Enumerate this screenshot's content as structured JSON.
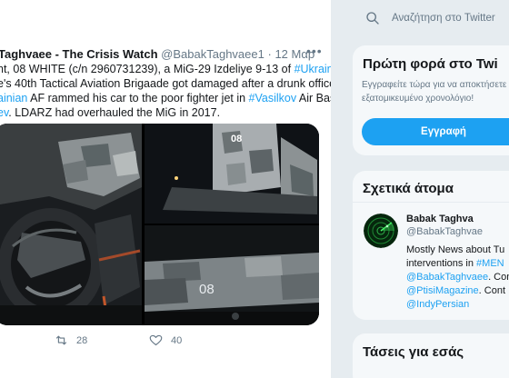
{
  "tweet": {
    "author_name": "Taghvaee - The Crisis Watch",
    "author_handle": "@BabakTaghvaee1",
    "separator": "·",
    "date": "12 Μαρ",
    "more_icon": "more-horizontal-icon",
    "text_lines": [
      {
        "segments": [
          {
            "text": "nt, 08 WHITE (c/n 2960731239), a MiG-29 Izdeliye 9-13 of ",
            "type": "text"
          },
          {
            "text": "#Ukraine",
            "type": "hashtag"
          }
        ]
      },
      {
        "segments": [
          {
            "text": "e's 40th Tactical Aviation Brigaade got damaged after a drunk officer",
            "type": "text"
          }
        ]
      },
      {
        "segments": [
          {
            "text": "ainian",
            "type": "hashtag"
          },
          {
            "text": " AF rammed his car to the poor fighter jet in ",
            "type": "text"
          },
          {
            "text": "#Vasilkov",
            "type": "hashtag"
          },
          {
            "text": " Air Base",
            "type": "text"
          }
        ]
      },
      {
        "segments": [
          {
            "text": "ev",
            "type": "hashtag"
          },
          {
            "text": ". LDARZ had overhauled the MiG in 2017.",
            "type": "text"
          }
        ]
      }
    ],
    "media": [
      {
        "id": "photo-damaged-engine",
        "alt": ""
      },
      {
        "id": "photo-tail-fins",
        "alt": ""
      },
      {
        "id": "photo-fuselage",
        "alt": "",
        "marking": "08"
      }
    ],
    "actions": {
      "retweet_icon": "retweet-icon",
      "retweet_count": "28",
      "like_icon": "heart-icon",
      "like_count": "40"
    }
  },
  "sidebar": {
    "search": {
      "icon": "search-icon",
      "placeholder": "Αναζήτηση στο Twitter"
    },
    "signup": {
      "title": "Πρώτη φορά στο Twi",
      "desc_lines": [
        "Εγγραφείτε τώρα για να αποκτήσετε το",
        "εξατομικευμένο χρονολόγιο!"
      ],
      "button_label": "Εγγραφή"
    },
    "relevant": {
      "title": "Σχετικά άτομα",
      "person": {
        "avatar_icon": "radar-avatar",
        "name": "Babak Taghva",
        "handle": "@BabakTaghvae",
        "bio_lines": [
          {
            "segments": [
              {
                "text": "Mostly News about Tu",
                "type": "text"
              }
            ]
          },
          {
            "segments": [
              {
                "text": "interventions in ",
                "type": "text"
              },
              {
                "text": "#MEN",
                "type": "hashtag"
              }
            ]
          },
          {
            "segments": [
              {
                "text": "@BabakTaghvaee",
                "type": "hashtag"
              },
              {
                "text": ". Con",
                "type": "text"
              }
            ]
          },
          {
            "segments": [
              {
                "text": "@PtisiMagazine",
                "type": "hashtag"
              },
              {
                "text": ". Cont",
                "type": "text"
              }
            ]
          },
          {
            "segments": [
              {
                "text": "@IndyPersian",
                "type": "hashtag"
              }
            ]
          }
        ]
      }
    },
    "trends": {
      "title": "Τάσεις για εσάς"
    }
  },
  "colors": {
    "accent": "#1da1f2",
    "text": "#14171a",
    "secondary_text": "#657786",
    "page_background": "#e6ecf0"
  }
}
